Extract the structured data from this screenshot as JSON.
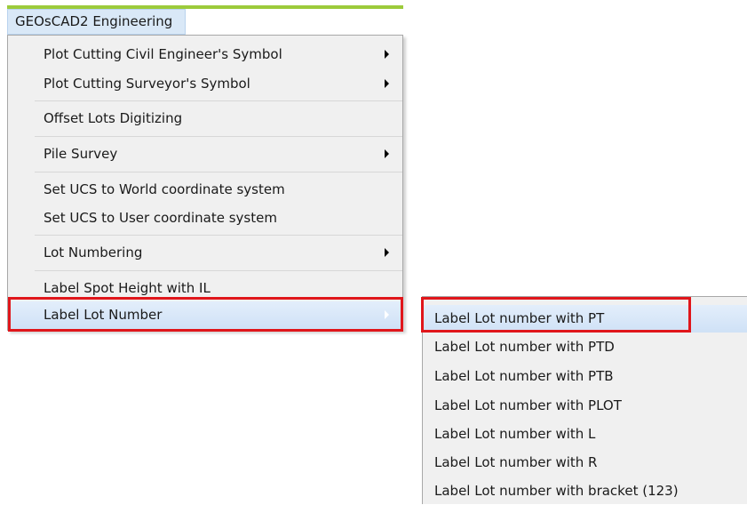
{
  "menubar": {
    "title": "GEOsCAD2 Engineering"
  },
  "menu": {
    "items": [
      {
        "label": "Plot Cutting Civil Engineer's Symbol",
        "submenu": true
      },
      {
        "label": "Plot Cutting Surveyor's Symbol",
        "submenu": true
      },
      {
        "label": "Offset Lots Digitizing",
        "submenu": false
      },
      {
        "label": "Pile Survey",
        "submenu": true
      },
      {
        "label": "Set UCS to World coordinate system",
        "submenu": false
      },
      {
        "label": "Set UCS to User coordinate system",
        "submenu": false
      },
      {
        "label": "Lot Numbering",
        "submenu": true
      },
      {
        "label": "Label Spot Height with IL",
        "submenu": false
      },
      {
        "label": "Label Lot Number",
        "submenu": true,
        "highlighted": true
      }
    ]
  },
  "submenu": {
    "items": [
      {
        "label": "Label Lot number with PT",
        "highlighted": true
      },
      {
        "label": "Label Lot number with PTD"
      },
      {
        "label": "Label Lot number with PTB"
      },
      {
        "label": "Label Lot number with PLOT"
      },
      {
        "label": "Label Lot number with L"
      },
      {
        "label": "Label Lot number with R"
      },
      {
        "label": "Label Lot number with bracket (123)"
      }
    ]
  },
  "colors": {
    "menubar_accent": "#9ccb3b",
    "highlight": "#cfe1f6",
    "annotation_box": "#e0161b",
    "menu_bg": "#f0f0f0"
  }
}
